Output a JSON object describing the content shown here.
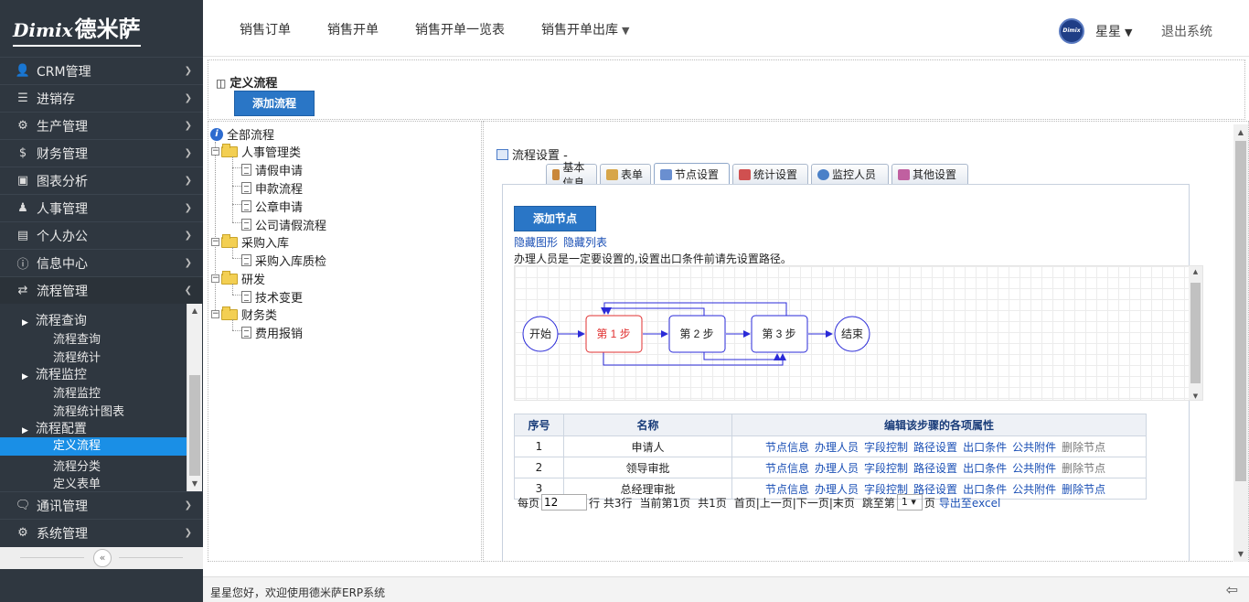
{
  "brand": {
    "latin": "Dimix",
    "cn": "德米萨"
  },
  "sidebar": {
    "items": [
      {
        "label": "CRM管理",
        "icon": "user-icon"
      },
      {
        "label": "进销存",
        "icon": "list-icon"
      },
      {
        "label": "生产管理",
        "icon": "cogs-icon"
      },
      {
        "label": "财务管理",
        "icon": "dollar-icon"
      },
      {
        "label": "图表分析",
        "icon": "picture-icon"
      },
      {
        "label": "人事管理",
        "icon": "person-icon"
      },
      {
        "label": "个人办公",
        "icon": "briefcase-icon"
      },
      {
        "label": "信息中心",
        "icon": "info-icon"
      },
      {
        "label": "流程管理",
        "icon": "exchange-icon"
      }
    ],
    "sub": {
      "query": "流程查询",
      "query_items": [
        "流程查询",
        "流程统计"
      ],
      "monitor": "流程监控",
      "monitor_items": [
        "流程监控",
        "流程统计图表"
      ],
      "config": "流程配置",
      "config_items": [
        "定义流程",
        "流程分类",
        "定义表单"
      ]
    },
    "bottom_items": [
      {
        "label": "通讯管理",
        "icon": "comment-icon"
      },
      {
        "label": "系统管理",
        "icon": "gear-icon"
      }
    ]
  },
  "topnav": {
    "items": [
      "销售订单",
      "销售开单",
      "销售开单一览表",
      "销售开单出库"
    ],
    "avatar_text": "Dimix 德米萨",
    "user": "星星",
    "logout": "退出系统"
  },
  "page": {
    "title": "定义流程",
    "add_flow": "添加流程"
  },
  "tree": {
    "root": "全部流程",
    "groups": [
      {
        "label": "人事管理类",
        "children": [
          "请假申请",
          "申款流程",
          "公章申请",
          "公司请假流程"
        ]
      },
      {
        "label": "采购入库",
        "children": [
          "采购入库质检"
        ]
      },
      {
        "label": "研发",
        "children": [
          "技术变更"
        ]
      },
      {
        "label": "财务类",
        "children": [
          "费用报销"
        ]
      }
    ]
  },
  "detail": {
    "title": "流程设置 -",
    "tabs": [
      "基本信息",
      "表单",
      "节点设置",
      "统计设置",
      "监控人员",
      "其他设置"
    ],
    "add_node": "添加节点",
    "hide_graph": "隐藏图形",
    "hide_list": "隐藏列表",
    "hint": "办理人员是一定要设置的,设置出口条件前请先设置路径。",
    "diagram": {
      "start": "开始",
      "steps": [
        "第 1 步",
        "第 2 步",
        "第 3 步"
      ],
      "end": "结束"
    },
    "table": {
      "headers": [
        "序号",
        "名称",
        "编辑该步骤的各项属性"
      ],
      "rows": [
        {
          "no": "1",
          "name": "申请人"
        },
        {
          "no": "2",
          "name": "领导审批"
        },
        {
          "no": "3",
          "name": "总经理审批"
        }
      ],
      "actions": [
        "节点信息",
        "办理人员",
        "字段控制",
        "路径设置",
        "出口条件",
        "公共附件",
        "删除节点"
      ]
    },
    "pager": {
      "per_page_label": "每页",
      "per_page": "12",
      "rows_text": "行 共3行",
      "current": "当前第1页",
      "total": "共1页",
      "nav": "首页|上一页|下一页|末页",
      "jump_label": "跳至第",
      "jump_value": "1",
      "page_suffix": "页",
      "export": "导出至excel"
    }
  },
  "footer": {
    "text": "星星您好，欢迎使用德米萨ERP系统"
  },
  "colors": {
    "sidebar_bg": "#2f3740",
    "active_blue": "#1a8fe6",
    "button_blue": "#2a76c6",
    "step_active": "#e03030",
    "step_border": "#3a3ad0"
  }
}
